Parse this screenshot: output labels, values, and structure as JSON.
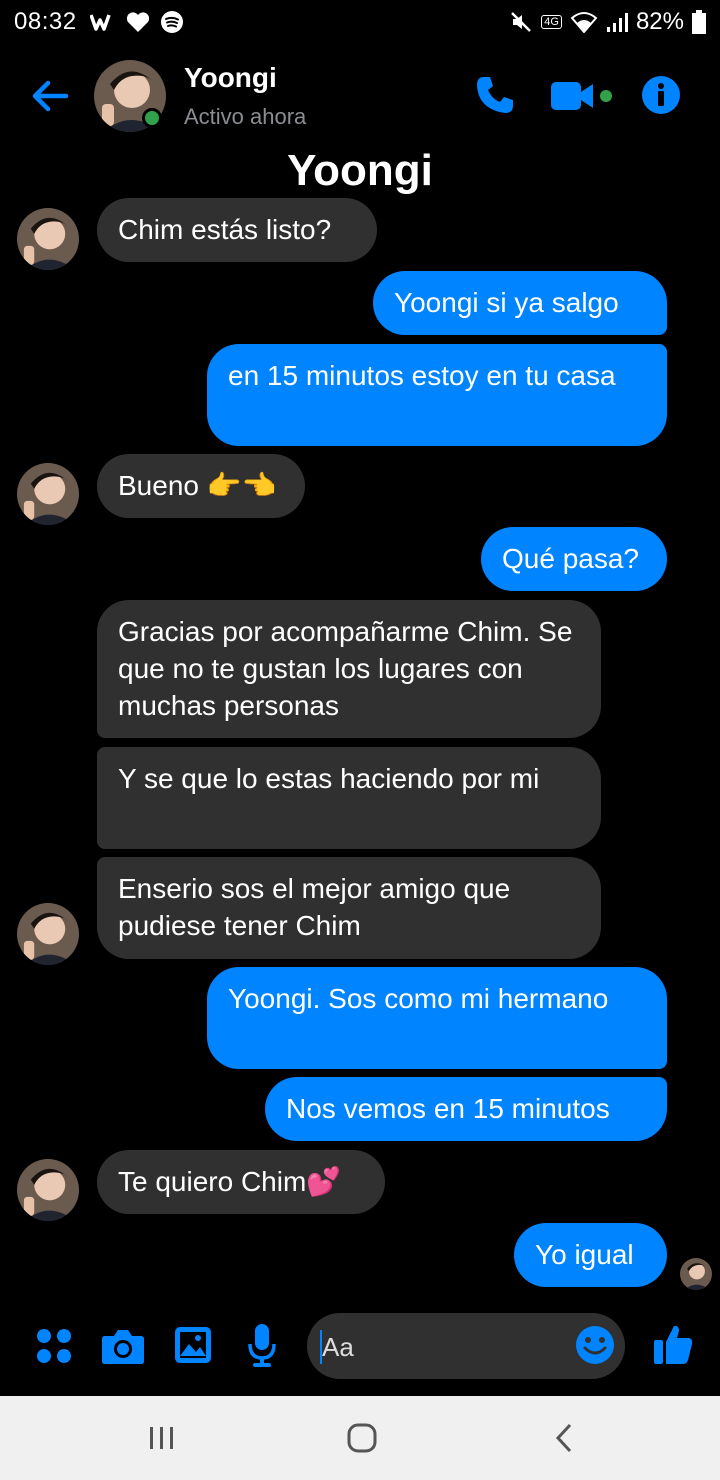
{
  "status_bar": {
    "time": "08:32",
    "battery": "82%",
    "network": "4G"
  },
  "header": {
    "name": "Yoongi",
    "status": "Activo ahora"
  },
  "conversation_title": "Yoongi",
  "messages": [
    {
      "sender": "Yoongi",
      "text": "Chim estás listo?"
    },
    {
      "sender": "me",
      "text": "Yoongi si ya salgo"
    },
    {
      "sender": "me",
      "text": "en 15 minutos estoy en tu casa"
    },
    {
      "sender": "Yoongi",
      "text": "Bueno 👉👈"
    },
    {
      "sender": "me",
      "text": "Qué pasa?"
    },
    {
      "sender": "Yoongi",
      "text": "Gracias por acompañarme Chim. Se que no te gustan los lugares con muchas personas"
    },
    {
      "sender": "Yoongi",
      "text": "Y se que lo estas haciendo por mi"
    },
    {
      "sender": "Yoongi",
      "text": "Enserio sos el mejor amigo que pudiese tener Chim"
    },
    {
      "sender": "me",
      "text": "Yoongi. Sos como mi hermano"
    },
    {
      "sender": "me",
      "text": "Nos vemos en 15 minutos"
    },
    {
      "sender": "Yoongi",
      "text": "Te quiero Chim💕"
    },
    {
      "sender": "me",
      "text": "Yo igual"
    }
  ],
  "composer": {
    "placeholder": "Aa"
  },
  "colors": {
    "accent": "#0084ff",
    "incoming_bubble": "#303030",
    "background": "#000000",
    "online": "#31a24c"
  },
  "icons": [
    "back-arrow-icon",
    "phone-icon",
    "video-icon",
    "info-icon",
    "menu-dots-icon",
    "camera-icon",
    "gallery-icon",
    "mic-icon",
    "emoji-icon",
    "thumbs-up-icon",
    "recents-icon",
    "home-icon",
    "nav-back-icon"
  ]
}
